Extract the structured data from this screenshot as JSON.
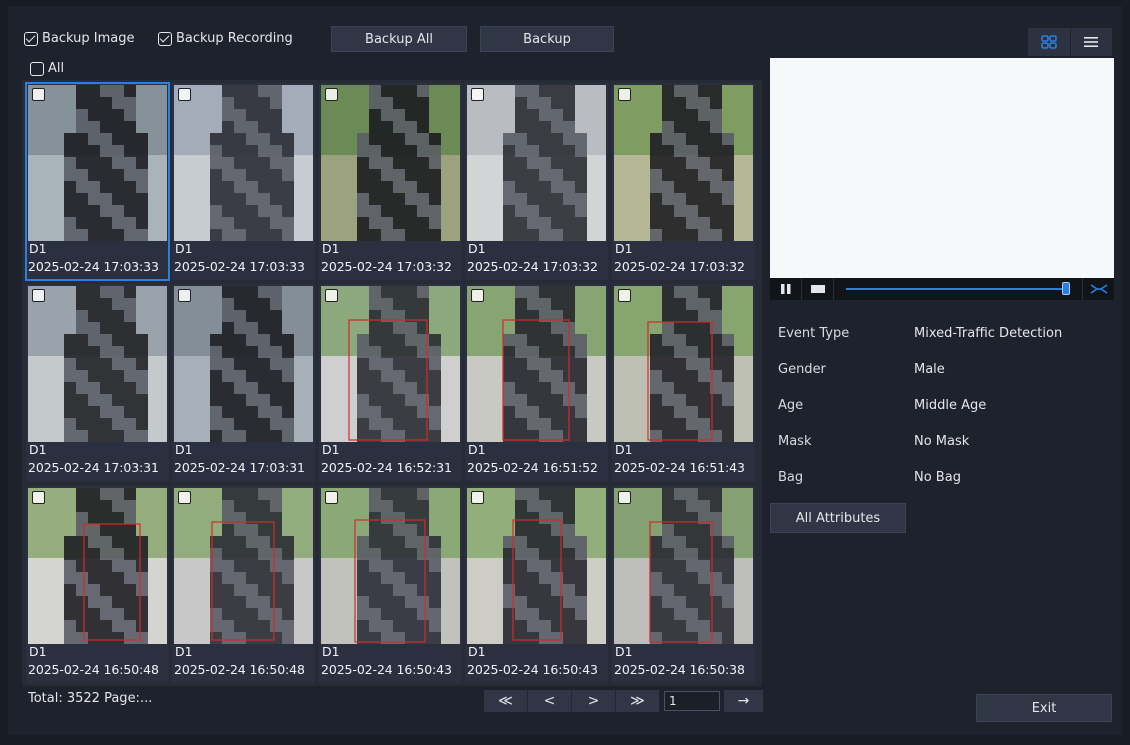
{
  "toolbar": {
    "backup_image_label": "Backup Image",
    "backup_recording_label": "Backup Recording",
    "backup_all_label": "Backup All",
    "backup_label": "Backup",
    "all_label": "All"
  },
  "view_icons": [
    "grid-view-icon",
    "list-view-icon"
  ],
  "accent_color": "#2b7fe0",
  "thumbnails": [
    {
      "channel": "D1",
      "timestamp": "2025-02-24 17:03:33"
    },
    {
      "channel": "D1",
      "timestamp": "2025-02-24 17:03:33"
    },
    {
      "channel": "D1",
      "timestamp": "2025-02-24 17:03:32"
    },
    {
      "channel": "D1",
      "timestamp": "2025-02-24 17:03:32"
    },
    {
      "channel": "D1",
      "timestamp": "2025-02-24 17:03:32"
    },
    {
      "channel": "D1",
      "timestamp": "2025-02-24 17:03:31"
    },
    {
      "channel": "D1",
      "timestamp": "2025-02-24 17:03:31"
    },
    {
      "channel": "D1",
      "timestamp": "2025-02-24 16:52:31"
    },
    {
      "channel": "D1",
      "timestamp": "2025-02-24 16:51:52"
    },
    {
      "channel": "D1",
      "timestamp": "2025-02-24 16:51:43"
    },
    {
      "channel": "D1",
      "timestamp": "2025-02-24 16:50:48"
    },
    {
      "channel": "D1",
      "timestamp": "2025-02-24 16:50:48"
    },
    {
      "channel": "D1",
      "timestamp": "2025-02-24 16:50:43"
    },
    {
      "channel": "D1",
      "timestamp": "2025-02-24 16:50:43"
    },
    {
      "channel": "D1",
      "timestamp": "2025-02-24 16:50:38"
    }
  ],
  "footer": {
    "total_text": "Total: 3522  Page:...",
    "page_input_value": "1",
    "pager": {
      "first": "≪",
      "prev": "<",
      "next": ">",
      "last": "≫",
      "go": "→"
    }
  },
  "attributes": [
    {
      "key": "Event Type",
      "value": "Mixed-Traffic Detection"
    },
    {
      "key": "Gender",
      "value": "Male"
    },
    {
      "key": "Age",
      "value": "Middle Age"
    },
    {
      "key": "Mask",
      "value": "No Mask"
    },
    {
      "key": "Bag",
      "value": "No Bag"
    }
  ],
  "all_attributes_label": "All Attributes",
  "exit_label": "Exit"
}
